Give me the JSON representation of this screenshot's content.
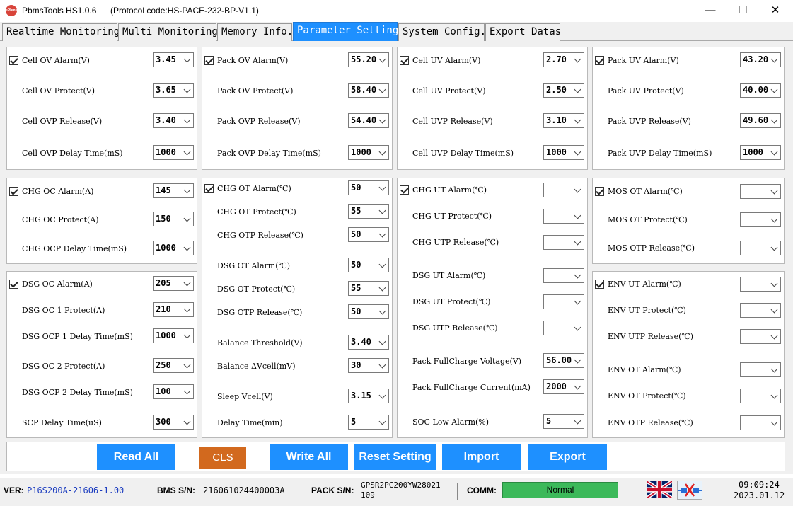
{
  "app": {
    "icon_text": "ePbms",
    "title": "PbmsTools HS1.0.6",
    "protocol": "(Protocol code:HS-PACE-232-BP-V1.1)"
  },
  "window": {
    "minimize": "—",
    "maximize": "☐",
    "close": "✕"
  },
  "tabs": [
    "Realtime Monitoring",
    "Multi Monitoring",
    "Memory Info.",
    "Parameter Setting",
    "System Config.",
    "Export Datas"
  ],
  "p1": {
    "r1": {
      "label": "Cell OV Alarm(V)",
      "value": "3.45"
    },
    "r2": {
      "label": "Cell OV Protect(V)",
      "value": "3.65"
    },
    "r3": {
      "label": "Cell OVP Release(V)",
      "value": "3.40"
    },
    "r4": {
      "label": "Cell OVP Delay Time(mS)",
      "value": "1000"
    }
  },
  "p2": {
    "r1": {
      "label": "Pack OV Alarm(V)",
      "value": "55.20"
    },
    "r2": {
      "label": "Pack OV Protect(V)",
      "value": "58.40"
    },
    "r3": {
      "label": "Pack OVP Release(V)",
      "value": "54.40"
    },
    "r4": {
      "label": "Pack OVP Delay Time(mS)",
      "value": "1000"
    }
  },
  "p3": {
    "r1": {
      "label": "Cell UV Alarm(V)",
      "value": "2.70"
    },
    "r2": {
      "label": "Cell UV Protect(V)",
      "value": "2.50"
    },
    "r3": {
      "label": "Cell UVP Release(V)",
      "value": "3.10"
    },
    "r4": {
      "label": "Cell UVP Delay Time(mS)",
      "value": "1000"
    }
  },
  "p4": {
    "r1": {
      "label": "Pack UV Alarm(V)",
      "value": "43.20"
    },
    "r2": {
      "label": "Pack UV Protect(V)",
      "value": "40.00"
    },
    "r3": {
      "label": "Pack UVP Release(V)",
      "value": "49.60"
    },
    "r4": {
      "label": "Pack UVP Delay Time(mS)",
      "value": "1000"
    }
  },
  "p5": {
    "r1": {
      "label": "CHG OC Alarm(A)",
      "value": "145"
    },
    "r2": {
      "label": "CHG OC Protect(A)",
      "value": "150"
    },
    "r3": {
      "label": "CHG OCP Delay Time(mS)",
      "value": "1000"
    }
  },
  "p6": {
    "r1": {
      "label": "DSG OC Alarm(A)",
      "value": "205"
    },
    "r2": {
      "label": "DSG OC 1 Protect(A)",
      "value": "210"
    },
    "r3": {
      "label": "DSG OCP 1 Delay Time(mS)",
      "value": "1000"
    },
    "r4": {
      "label": "DSG OC 2 Protect(A)",
      "value": "250"
    },
    "r5": {
      "label": "DSG OCP 2 Delay Time(mS)",
      "value": "100"
    },
    "r6": {
      "label": "SCP Delay Time(uS)",
      "value": "300"
    }
  },
  "p7": {
    "r1": {
      "label": "CHG OT Alarm(℃)",
      "value": "50"
    },
    "r2": {
      "label": "CHG OT Protect(℃)",
      "value": "55"
    },
    "r3": {
      "label": "CHG OTP Release(℃)",
      "value": "50"
    },
    "r4": {
      "label": "DSG OT Alarm(℃)",
      "value": "50"
    },
    "r5": {
      "label": "DSG OT Protect(℃)",
      "value": "55"
    },
    "r6": {
      "label": "DSG OTP Release(℃)",
      "value": "50"
    },
    "r7": {
      "label": "Balance Threshold(V)",
      "value": "3.40"
    },
    "r8": {
      "label": "Balance ΔVcell(mV)",
      "value": "30"
    },
    "r9": {
      "label": "Sleep Vcell(V)",
      "value": "3.15"
    },
    "r10": {
      "label": "Delay Time(min)",
      "value": "5"
    }
  },
  "p8": {
    "r1": {
      "label": "CHG UT Alarm(℃)",
      "value": ""
    },
    "r2": {
      "label": "CHG UT Protect(℃)",
      "value": ""
    },
    "r3": {
      "label": "CHG UTP Release(℃)",
      "value": ""
    },
    "r4": {
      "label": "DSG UT Alarm(℃)",
      "value": ""
    },
    "r5": {
      "label": "DSG UT Protect(℃)",
      "value": ""
    },
    "r6": {
      "label": "DSG UTP Release(℃)",
      "value": ""
    },
    "r7": {
      "label": "Pack FullCharge Voltage(V)",
      "value": "56.00"
    },
    "r8": {
      "label": "Pack FullCharge Current(mA)",
      "value": "2000"
    },
    "r9": {
      "label": "SOC Low Alarm(%)",
      "value": "5"
    }
  },
  "p9": {
    "r1": {
      "label": "MOS OT Alarm(℃)",
      "value": ""
    },
    "r2": {
      "label": "MOS OT Protect(℃)",
      "value": ""
    },
    "r3": {
      "label": "MOS OTP Release(℃)",
      "value": ""
    }
  },
  "p10": {
    "r1": {
      "label": "ENV UT Alarm(℃)",
      "value": ""
    },
    "r2": {
      "label": "ENV UT Protect(℃)",
      "value": ""
    },
    "r3": {
      "label": "ENV UTP Release(℃)",
      "value": ""
    },
    "r4": {
      "label": "ENV OT Alarm(℃)",
      "value": ""
    },
    "r5": {
      "label": "ENV OT Protect(℃)",
      "value": ""
    },
    "r6": {
      "label": "ENV OTP Release(℃)",
      "value": ""
    }
  },
  "actions": {
    "read_all": "Read All",
    "cls": "CLS",
    "write_all": "Write All",
    "reset": "Reset Setting",
    "import": "Import",
    "export": "Export"
  },
  "status": {
    "ver_label": "VER:",
    "ver_value": "P16S200A-21606-1.00",
    "bms_label": "BMS S/N:",
    "bms_value": "216061024400003A",
    "pack_label": "PACK S/N:",
    "pack_value_1": "GPSR2PC200YW28021",
    "pack_value_2": "109",
    "comm_label": "COMM:",
    "comm_value": "Normal",
    "time": "09:09:24",
    "date": "2023.01.12"
  },
  "colors": {
    "accent": "#1e90ff",
    "cls": "#d2691e",
    "comm_ok": "#3cb95a"
  },
  "icons": {
    "flag": "uk-flag-icon",
    "disconnect": "disconnect-plug-icon"
  }
}
